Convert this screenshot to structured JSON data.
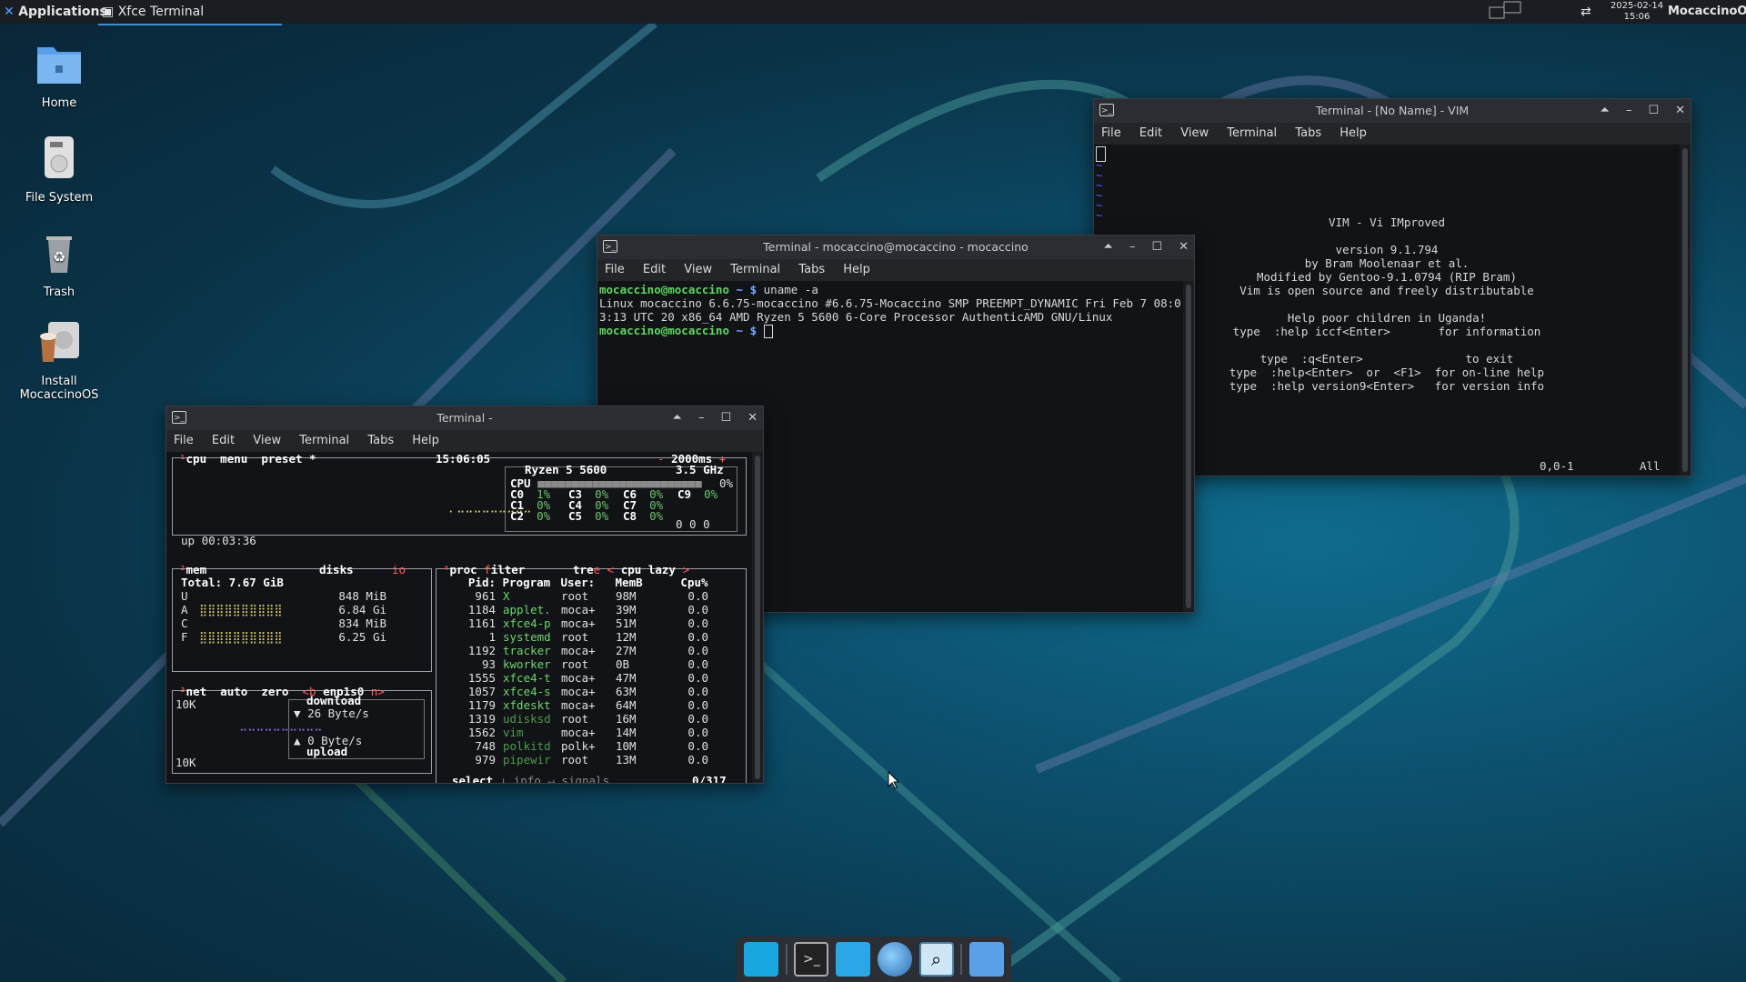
{
  "panel": {
    "applications_label": "Applications",
    "task_label": "Xfce Terminal",
    "date": "2025-02-14",
    "time": "15:06",
    "user": "MocaccinoOS"
  },
  "desktop_icons": [
    {
      "label": "Home"
    },
    {
      "label": "File System"
    },
    {
      "label": "Trash"
    },
    {
      "label": "Install MocaccinoOS"
    }
  ],
  "menu_items": [
    "File",
    "Edit",
    "View",
    "Terminal",
    "Tabs",
    "Help"
  ],
  "vim_window": {
    "title": "Terminal - [No Name] - VIM",
    "lines": [
      "VIM - Vi IMproved",
      "",
      "version 9.1.794",
      "by Bram Moolenaar et al.",
      "Modified by Gentoo-9.1.0794 (RIP Bram)",
      "Vim is open source and freely distributable",
      "",
      "Help poor children in Uganda!",
      "type  :help iccf<Enter>       for information",
      "",
      "type  :q<Enter>               to exit",
      "type  :help<Enter>  or  <F1>  for on-line help",
      "type  :help version9<Enter>   for version info"
    ],
    "ruler": "0,0-1",
    "ruler_pos": "All"
  },
  "main_terminal": {
    "title": "Terminal - mocaccino@mocaccino - mocaccino",
    "prompt_user": "mocaccino@mocaccino",
    "prompt_path": "~ $",
    "command": "uname -a",
    "output": "Linux mocaccino 6.6.75-mocaccino #6.6.75-Mocaccino SMP PREEMPT_DYNAMIC Fri Feb 7 08:03:13 UTC 20 x86_64 AMD Ryzen 5 5600 6-Core Processor AuthenticAMD GNU/Linux"
  },
  "btop_window": {
    "title": "Terminal -",
    "clock": "15:06:05",
    "interval": "2000ms",
    "cpu_model": "Ryzen 5 5600",
    "cpu_freq": "3.5 GHz",
    "uptime": "up 00:03:36",
    "cpu_total": "0%",
    "cores": [
      {
        "name": "C0",
        "val": "1%"
      },
      {
        "name": "C3",
        "val": "0%"
      },
      {
        "name": "C6",
        "val": "0%"
      },
      {
        "name": "C9",
        "val": "0%"
      },
      {
        "name": "C1",
        "val": "0%"
      },
      {
        "name": "C4",
        "val": "0%"
      },
      {
        "name": "C7",
        "val": "0%"
      },
      {
        "name": "C2",
        "val": "0%"
      },
      {
        "name": "C5",
        "val": "0%"
      },
      {
        "name": "C8",
        "val": "0%"
      }
    ],
    "load": "0 0 0",
    "mem_total": "Total: 7.67 GiB",
    "mem": [
      {
        "k": "U",
        "v": "848 MiB"
      },
      {
        "k": "A",
        "v": "6.84 Gi"
      },
      {
        "k": "C",
        "v": "834 MiB"
      },
      {
        "k": "F",
        "v": "6.25 Gi"
      }
    ],
    "net_iface": "enp1s0",
    "net_scale": "10K",
    "download": "26 Byte/s",
    "upload": "0 Byte/s",
    "proc_headers": [
      "Pid:",
      "Program",
      "User:",
      "MemB",
      "Cpu%"
    ],
    "procs": [
      [
        "961",
        "X",
        "root",
        "98M",
        "0.0"
      ],
      [
        "1184",
        "applet.",
        "moca+",
        "39M",
        "0.0"
      ],
      [
        "1161",
        "xfce4-p",
        "moca+",
        "51M",
        "0.0"
      ],
      [
        "1",
        "systemd",
        "root",
        "12M",
        "0.0"
      ],
      [
        "1192",
        "tracker",
        "moca+",
        "27M",
        "0.0"
      ],
      [
        "93",
        "kworker",
        "root",
        "0B",
        "0.0"
      ],
      [
        "1555",
        "xfce4-t",
        "moca+",
        "47M",
        "0.0"
      ],
      [
        "1057",
        "xfce4-s",
        "moca+",
        "63M",
        "0.0"
      ],
      [
        "1179",
        "xfdeskt",
        "moca+",
        "64M",
        "0.0"
      ],
      [
        "1319",
        "udisksd",
        "root",
        "16M",
        "0.0"
      ],
      [
        "1562",
        "vim",
        "moca+",
        "14M",
        "0.0"
      ],
      [
        "748",
        "polkitd",
        "polk+",
        "10M",
        "0.0"
      ],
      [
        "979",
        "pipewir",
        "root",
        "13M",
        "0.0"
      ]
    ],
    "proc_count": "0/317"
  },
  "colors": {
    "accent": "#3b8dd6",
    "prompt_green": "#5fd75f",
    "prompt_blue": "#7aa7ff"
  }
}
